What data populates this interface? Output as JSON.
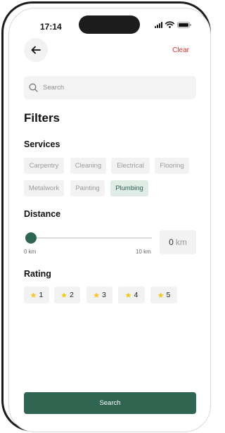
{
  "status_bar": {
    "time": "17:14",
    "icons": [
      "cellular-signal-icon",
      "wifi-icon",
      "battery-icon"
    ]
  },
  "header": {
    "back_icon": "arrow-left-icon",
    "clear_label": "Clear"
  },
  "search": {
    "placeholder": "Search",
    "value": "",
    "icon": "search-icon"
  },
  "page_title": "Filters",
  "services": {
    "title": "Services",
    "chips": [
      {
        "label": "Carpentry",
        "selected": false
      },
      {
        "label": "Cleaning",
        "selected": false
      },
      {
        "label": "Electrical",
        "selected": false
      },
      {
        "label": "Flooring",
        "selected": false
      },
      {
        "label": "Metalwork",
        "selected": false
      },
      {
        "label": "Painting",
        "selected": false
      },
      {
        "label": "Plumbing",
        "selected": true
      }
    ]
  },
  "distance": {
    "title": "Distance",
    "min_label": "0 km",
    "max_label": "10 km",
    "value": "0",
    "unit": "km",
    "level": 0
  },
  "rating": {
    "title": "Rating",
    "star_icon": "star-icon",
    "options": [
      "1",
      "2",
      "3",
      "4",
      "5"
    ]
  },
  "footer": {
    "search_button_label": "Search"
  },
  "colors": {
    "accent": "#2f6551",
    "accent_light": "#dfece5",
    "clear": "#e0332b",
    "star": "#f5c518",
    "chip_bg": "#f2f2f2"
  }
}
